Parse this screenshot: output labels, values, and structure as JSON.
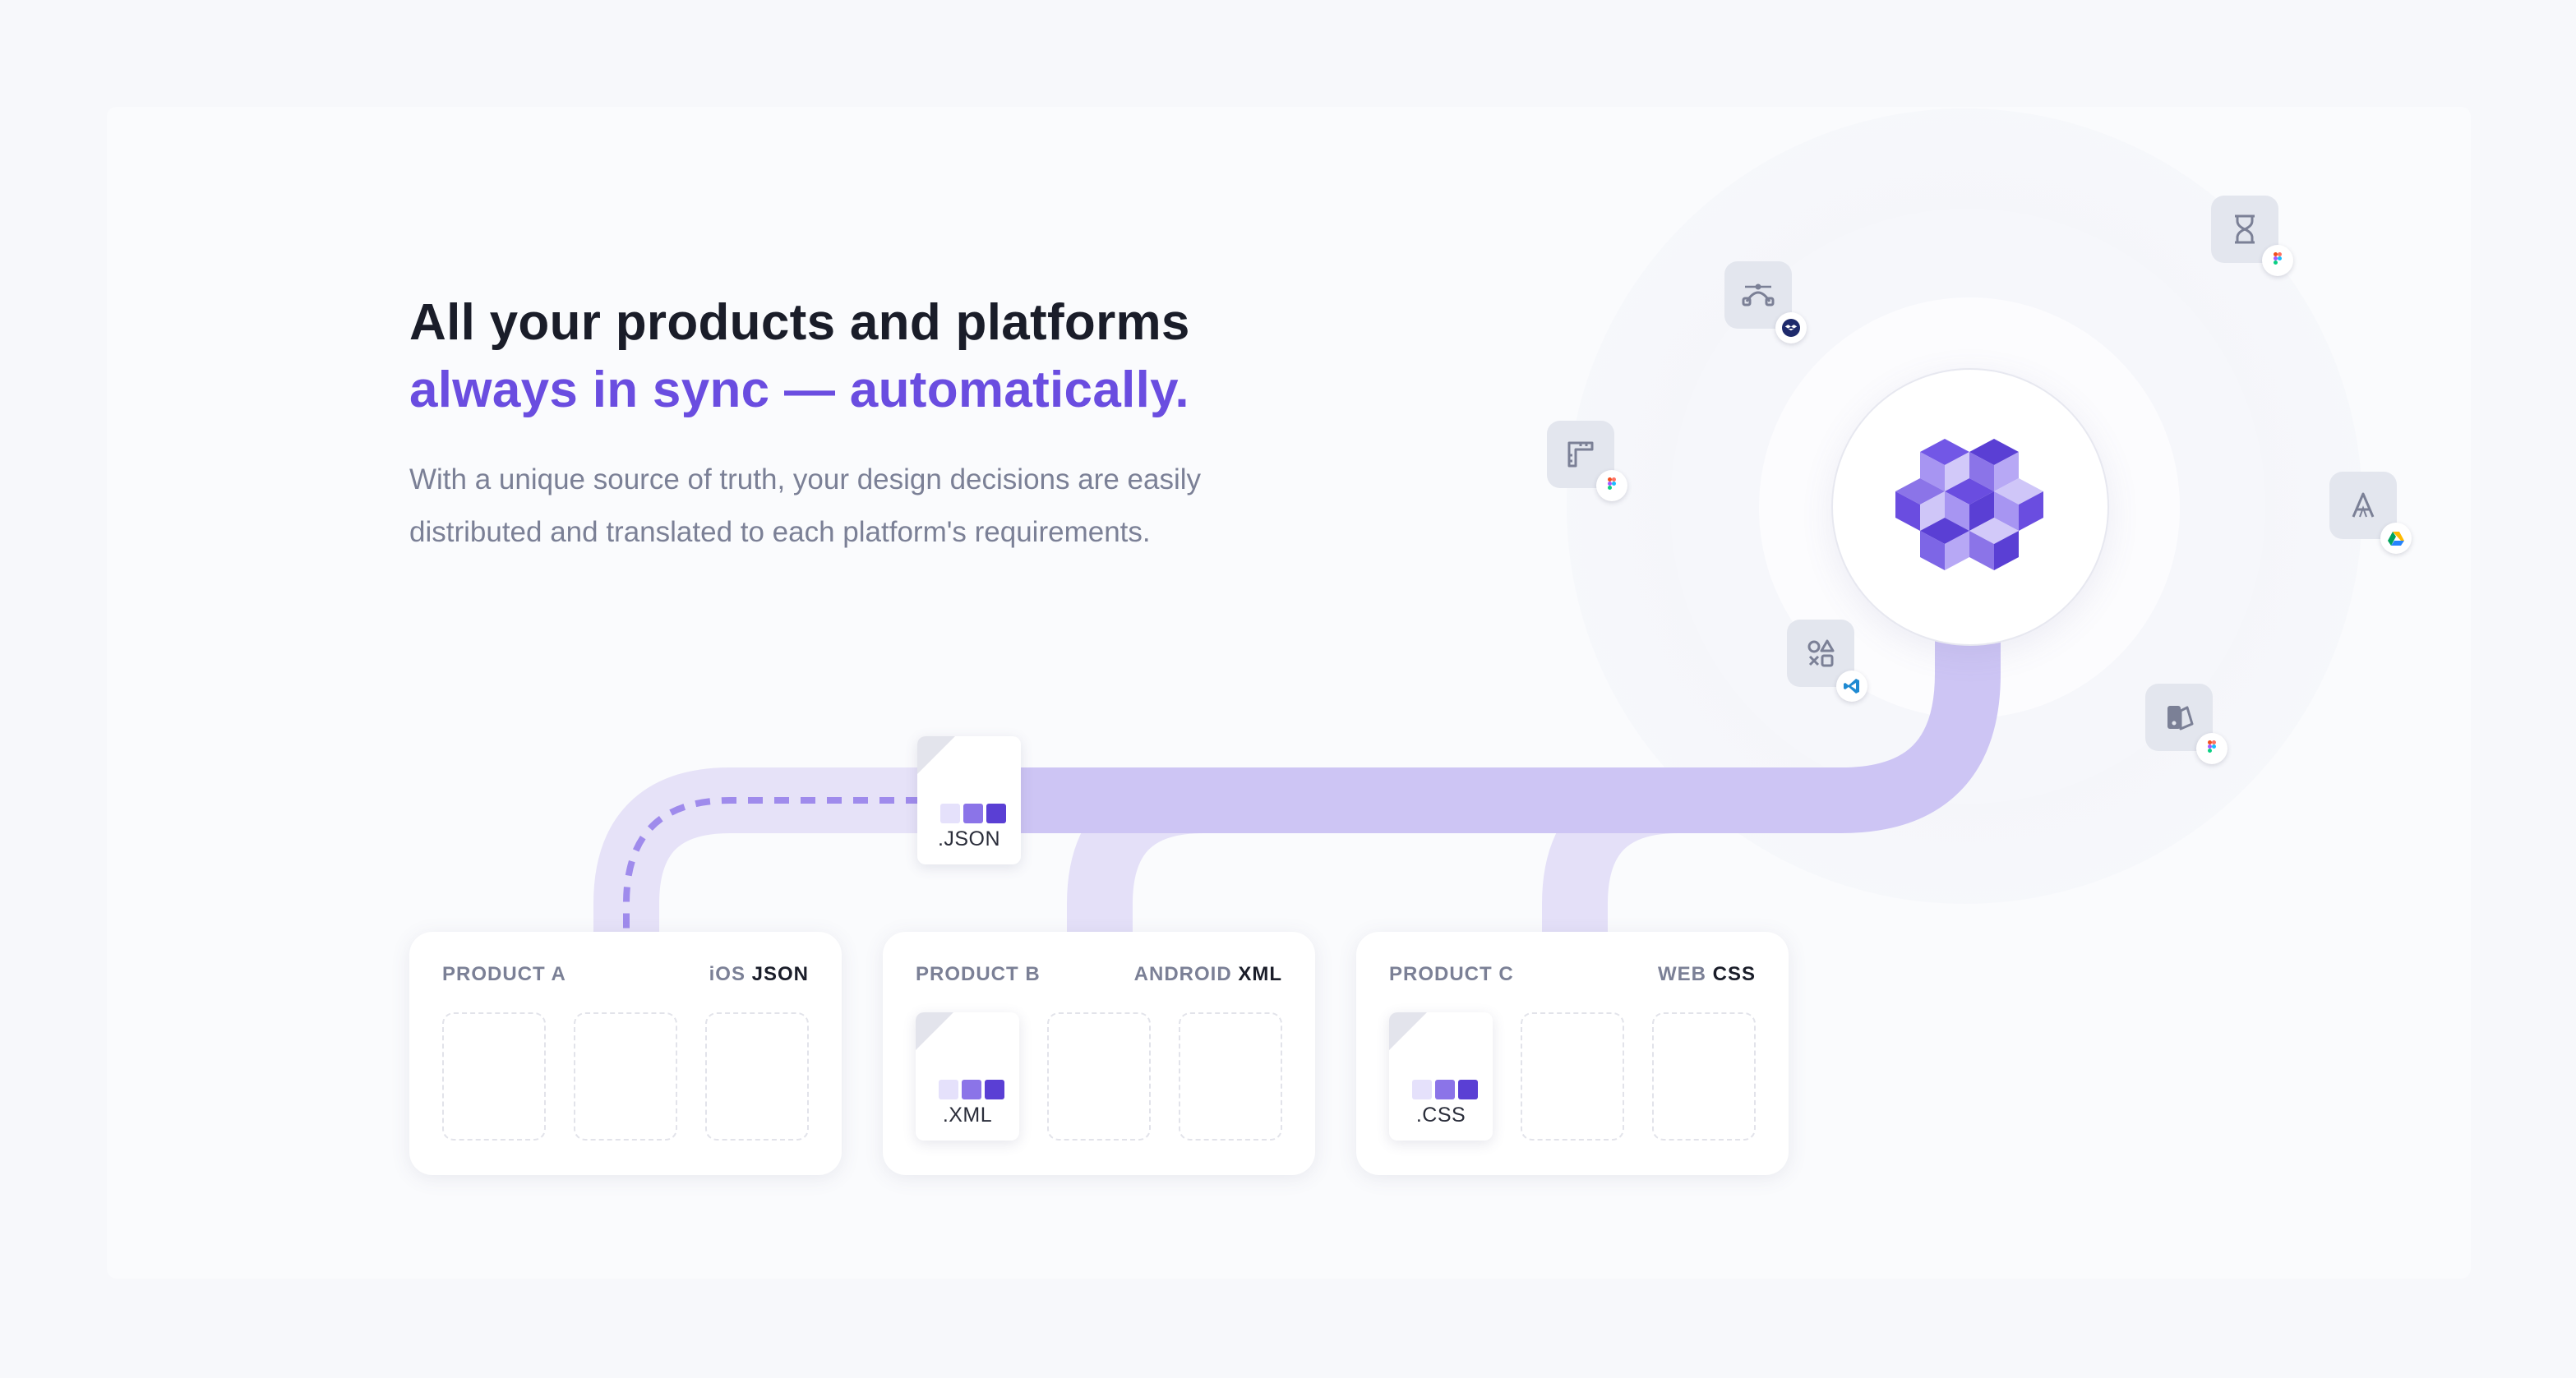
{
  "headline": {
    "line1": "All your products and platforms",
    "line2": "always in sync — automatically."
  },
  "lede": {
    "line1": "With a unique source of truth, your design decisions are easily",
    "line2": "distributed and translated to each platform's requirements."
  },
  "hub": {
    "logo_icon": "isometric-cubes-logo-icon"
  },
  "tools": [
    {
      "icon": "bezier-curve-icon",
      "badge": "dropbox-icon"
    },
    {
      "icon": "hourglass-icon",
      "badge": "figma-icon"
    },
    {
      "icon": "layout-grid-icon",
      "badge": "figma-icon"
    },
    {
      "icon": "typography-icon",
      "badge": "google-drive-icon"
    },
    {
      "icon": "shapes-icon",
      "badge": "vscode-icon"
    },
    {
      "icon": "color-swatch-icon",
      "badge": "figma-icon"
    }
  ],
  "source_file": {
    "ext": ".JSON"
  },
  "products": [
    {
      "name": "PRODUCT A",
      "platform": "iOS",
      "format": "JSON",
      "file_ext": ""
    },
    {
      "name": "PRODUCT B",
      "platform": "ANDROID",
      "format": "XML",
      "file_ext": ".XML"
    },
    {
      "name": "PRODUCT C",
      "platform": "WEB",
      "format": "CSS",
      "file_ext": ".CSS"
    }
  ],
  "colors": {
    "accent": "#6a4de0",
    "path": "#cdc5f4",
    "swatch_light": "#e5e1fb",
    "swatch_mid": "#8b74e8",
    "swatch_dark": "#5a3fd4"
  }
}
